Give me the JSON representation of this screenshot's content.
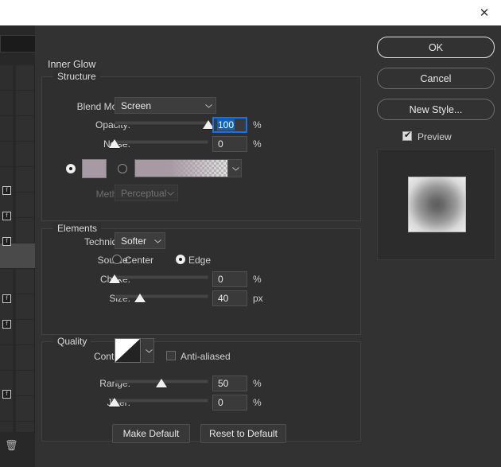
{
  "window": {
    "close_icon": "✕"
  },
  "dialog": {
    "effect_title": "Inner Glow",
    "structure": {
      "label": "Structure",
      "blend_mode": {
        "label": "Blend Mode:",
        "value": "Screen"
      },
      "opacity": {
        "label": "Opacity:",
        "value": "100",
        "unit": "%",
        "slider_pct": 100
      },
      "noise": {
        "label": "Noise:",
        "value": "0",
        "unit": "%",
        "slider_pct": 0
      },
      "fill_type": {
        "color_selected": true,
        "color_value": "#a89aa4",
        "gradient_selected": false
      },
      "method": {
        "label": "Method:",
        "value": "Perceptual",
        "disabled": true
      }
    },
    "elements": {
      "label": "Elements",
      "technique": {
        "label": "Technique:",
        "value": "Softer"
      },
      "source": {
        "label": "Source:",
        "center_label": "Center",
        "edge_label": "Edge",
        "selected": "Edge"
      },
      "choke": {
        "label": "Choke:",
        "value": "0",
        "unit": "%",
        "slider_pct": 0
      },
      "size": {
        "label": "Size:",
        "value": "40",
        "unit": "px",
        "slider_pct": 27
      }
    },
    "quality": {
      "label": "Quality",
      "contour": {
        "label": "Contour:",
        "shape": "linear"
      },
      "anti_aliased": {
        "label": "Anti-aliased",
        "checked": false
      },
      "range": {
        "label": "Range:",
        "value": "50",
        "unit": "%",
        "slider_pct": 50
      },
      "jitter": {
        "label": "Jitter:",
        "value": "0",
        "unit": "%",
        "slider_pct": 0
      }
    },
    "footer": {
      "make_default": "Make Default",
      "reset_to_default": "Reset to Default"
    },
    "actions": {
      "ok": "OK",
      "cancel": "Cancel",
      "new_style": "New Style...",
      "preview": {
        "label": "Preview",
        "checked": true
      }
    }
  },
  "background": {
    "fx_badge": "f",
    "trash_icon": "🗑"
  },
  "colors": {
    "dialog_bg": "#323232",
    "accent_focus": "#1473e6",
    "selection": "#0b66c3",
    "glow_color": "#a89aa4"
  }
}
